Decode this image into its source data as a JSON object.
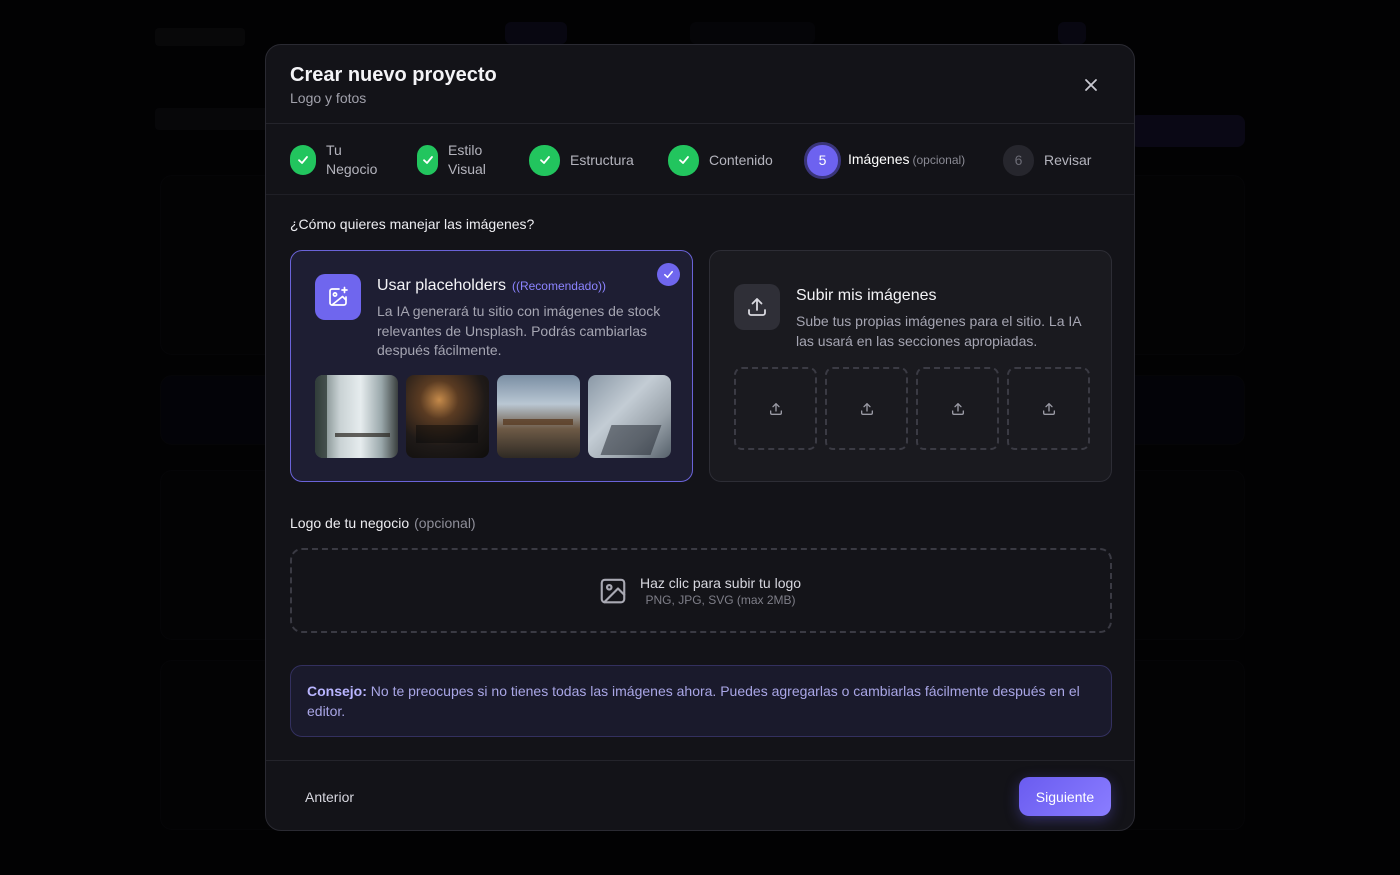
{
  "modal": {
    "title": "Crear nuevo proyecto",
    "subtitle": "Logo y fotos",
    "close_icon": "close-icon"
  },
  "steps": [
    {
      "number": "1",
      "label": "Tu Negocio",
      "status": "complete"
    },
    {
      "number": "2",
      "label": "Estilo Visual",
      "status": "complete"
    },
    {
      "number": "3",
      "label": "Estructura",
      "status": "complete"
    },
    {
      "number": "4",
      "label": "Contenido",
      "status": "complete"
    },
    {
      "number": "5",
      "label": "Imágenes",
      "optional": "(opcional)",
      "status": "active"
    },
    {
      "number": "6",
      "label": "Revisar",
      "status": "pending"
    }
  ],
  "images_section": {
    "question": "¿Cómo quieres manejar las imágenes?",
    "placeholders_option": {
      "title": "Usar placeholders",
      "badge": "((Recomendado))",
      "description": "La IA generará tu sitio con imágenes de stock relevantes de Unsplash. Podrás cambiarlas después fácilmente.",
      "selected": true,
      "icon": "image-plus-icon"
    },
    "upload_option": {
      "title": "Subir mis imágenes",
      "description": "Sube tus propias imágenes para el sitio. La IA las usará en las secciones apropiadas.",
      "selected": false,
      "icon": "upload-icon"
    }
  },
  "logo_section": {
    "label": "Logo de tu negocio",
    "optional": "(opcional)",
    "upload_text": "Haz clic para subir tu logo",
    "upload_hint": "PNG, JPG, SVG (max 2MB)",
    "icon": "image-icon"
  },
  "tip": {
    "label": "Consejo:",
    "text": "No te preocupes si no tienes todas las imágenes ahora. Puedes agregarlas o cambiarlas fácilmente después en el editor."
  },
  "footer": {
    "prev_label": "Anterior",
    "next_label": "Siguiente"
  },
  "colors": {
    "accent": "#6f66ee",
    "success": "#22c55e",
    "modal_bg": "#131318"
  }
}
